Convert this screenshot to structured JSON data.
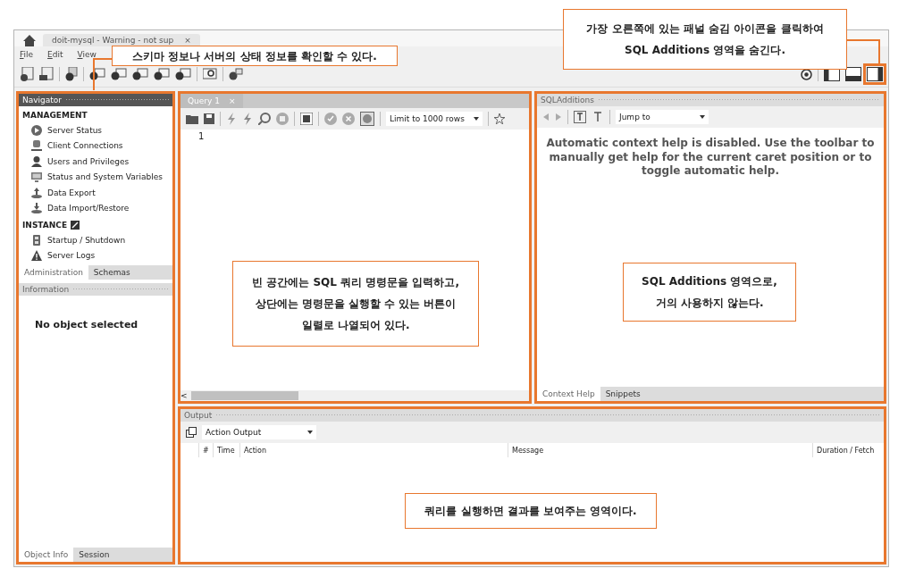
{
  "window": {
    "tab": {
      "title": "doit-mysql - Warning - not sup",
      "close": "×"
    }
  },
  "menu": [
    "File",
    "Edit",
    "View"
  ],
  "navigator": {
    "title": "Navigator",
    "sections": [
      {
        "heading": "MANAGEMENT",
        "items": [
          "Server Status",
          "Client Connections",
          "Users and Privileges",
          "Status and System Variables",
          "Data Export",
          "Data Import/Restore"
        ]
      },
      {
        "heading": "INSTANCE",
        "items": [
          "Startup / Shutdown",
          "Server Logs"
        ]
      }
    ],
    "tabs": [
      {
        "label": "Administration",
        "selected": true
      },
      {
        "label": "Schemas",
        "selected": false
      }
    ],
    "information": {
      "title": "Information",
      "text": "No object selected"
    },
    "bottom_tabs": [
      {
        "label": "Object Info",
        "selected": true
      },
      {
        "label": "Session",
        "selected": false
      }
    ]
  },
  "query": {
    "tab": {
      "label": "Query 1",
      "close": "×"
    },
    "limit": "Limit to 1000 rows",
    "line_number": "1",
    "scroll_left": "<"
  },
  "sql_additions": {
    "title": "SQLAdditions",
    "jump": "Jump to",
    "help": "Automatic context help is disabled. Use the toolbar to manually get help for the current caret position or to toggle automatic help.",
    "tabs": [
      {
        "label": "Context Help",
        "selected": true
      },
      {
        "label": "Snippets",
        "selected": false
      }
    ]
  },
  "output": {
    "title": "Output",
    "select": "Action Output",
    "columns": [
      "#",
      "Time",
      "Action",
      "Message",
      "Duration / Fetch"
    ]
  },
  "callouts": [
    {
      "kind": "top",
      "lines": [
        "스키마 정보나 서버의 상태 정보를 확인할 수 있다."
      ]
    },
    {
      "kind": "corner",
      "lines": [
        "가장 오른쪽에 있는 패널 숨김 아이콘을 클릭하여",
        "SQL Additions 영역을 숨긴다."
      ]
    },
    {
      "kind": "query",
      "lines": [
        "빈 공간에는 SQL 쿼리 명령문을 입력하고,",
        "상단에는 명령문을 실행할 수 있는 버튼이",
        "일렬로 나열되어 있다."
      ]
    },
    {
      "kind": "additions",
      "lines": [
        "SQL Additions 영역으로,",
        "거의 사용하지 않는다."
      ]
    },
    {
      "kind": "output",
      "lines": [
        "쿼리를 실행하면 결과를 보여주는 영역이다."
      ]
    }
  ]
}
